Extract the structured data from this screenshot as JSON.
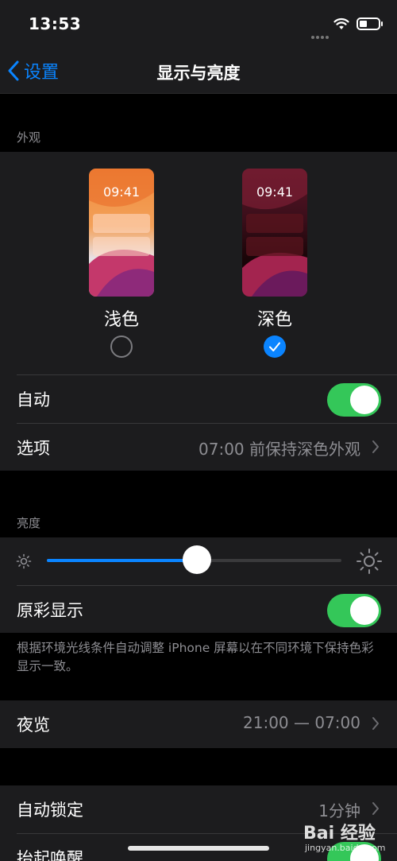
{
  "status_bar": {
    "time": "13:53",
    "icons": [
      "signal-dots",
      "wifi-icon",
      "battery-icon"
    ]
  },
  "nav": {
    "back_label": "设置",
    "title": "显示与亮度"
  },
  "appearance": {
    "header": "外观",
    "light": {
      "preview_time": "09:41",
      "label": "浅色",
      "selected": false
    },
    "dark": {
      "preview_time": "09:41",
      "label": "深色",
      "selected": true
    },
    "auto_label": "自动",
    "auto_on": true,
    "options_label": "选项",
    "options_value": "07:00 前保持深色外观"
  },
  "brightness": {
    "header": "亮度",
    "level_fraction": 0.51,
    "true_tone_label": "原彩显示",
    "true_tone_on": true,
    "footnote": "根据环境光线条件自动调整 iPhone 屏幕以在不同环境下保持色彩显示一致。"
  },
  "night_shift": {
    "label": "夜览",
    "value": "21:00 — 07:00"
  },
  "lock": {
    "auto_lock_label": "自动锁定",
    "auto_lock_value": "1分钟",
    "raise_to_wake_label": "抬起唤醒"
  },
  "watermark": {
    "brand": "Bai 经验",
    "url": "jingyan.baidu.com"
  },
  "colors": {
    "accent": "#0a84ff",
    "toggle_on": "#34c759",
    "cell_bg": "#1c1c1e",
    "bg": "#000000"
  }
}
